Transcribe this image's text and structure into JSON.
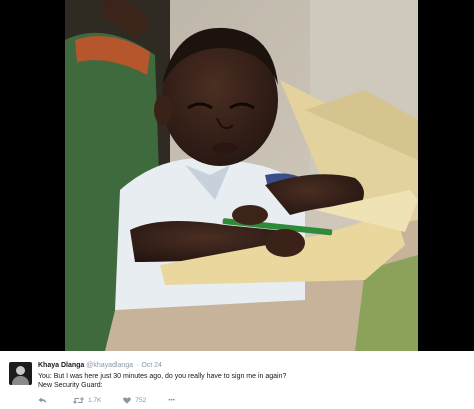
{
  "photo": {
    "alt_icon": "photo-image"
  },
  "tweet": {
    "author_name": "Khaya Dlanga",
    "author_handle": "@khayadlanga",
    "separator": "·",
    "date": "Oct 24",
    "line1": "You: But I was here just 30 minutes ago, do you really have to sign me in again?",
    "line2": "New Security Guard:",
    "actions": {
      "reply_icon": "reply-icon",
      "retweet_icon": "retweet-icon",
      "retweet_count": "1.7K",
      "like_icon": "heart-icon",
      "like_count": "752",
      "more_icon": "more-icon",
      "more_label": "•••"
    }
  },
  "colors": {
    "frame": "#000000",
    "name": "#14171a",
    "meta": "#8899a6"
  }
}
